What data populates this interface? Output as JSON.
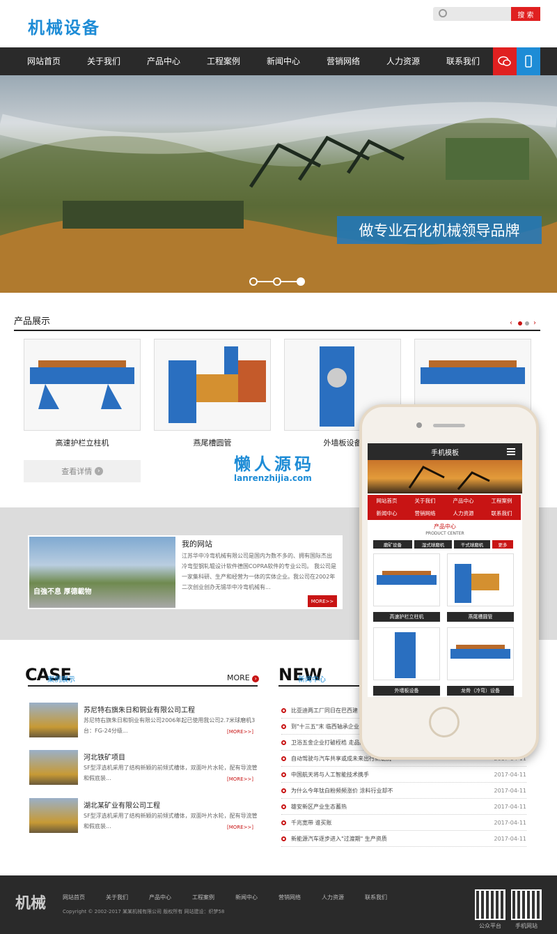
{
  "header": {
    "logo": "机械设备",
    "search": {
      "placeholder": "",
      "button": "搜 索"
    }
  },
  "nav": {
    "items": [
      "网站首页",
      "关于我们",
      "产品中心",
      "工程案例",
      "新闻中心",
      "营销网络",
      "人力资源",
      "联系我们"
    ]
  },
  "banner": {
    "slogan": "做专业石化机械领导品牌",
    "active_slide": 3,
    "slide_count": 3
  },
  "products": {
    "title": "产品展示",
    "items": [
      "高速护栏立柱机",
      "燕尾槽圆管",
      "外墙板设备",
      ""
    ],
    "more_label": "查看详情"
  },
  "about": {
    "title": "我的网站",
    "text": "江苏华中冷弯机械有限公司是国内为数不多的、拥有国际杰出冷弯型钢轧辊设计软件德国COPRA软件的专业公司。 我公司是一家集科研、生产和经营为一体的实体企业。我公司在2002年二次创业创办无锡华中冷弯机械有...",
    "more": "MORE>>",
    "image_text": "自強不息 厚德載物"
  },
  "cases": {
    "heading": "CASE",
    "subheading": "案例展示",
    "more": "MORE",
    "items": [
      {
        "title": "苏尼特右旗朱日和铜业有限公司工程",
        "desc": "苏尼特右旗朱日和铜业有限公司2006年起已使用我公司2.7米球磨机3台：FG-24分级...",
        "link": "[MORE>>]"
      },
      {
        "title": "河北铁矿项目",
        "desc": "SF型浮选机采用了结构新颖的前倾式槽体，双面叶片水轮，配有导流管和假底装...",
        "link": "[MORE>>]"
      },
      {
        "title": "湖北某矿业有限公司工程",
        "desc": "SF型浮选机采用了结构新颖的前倾式槽体，双面叶片水轮，配有导流管和假底装...",
        "link": "[MORE>>]"
      }
    ]
  },
  "news": {
    "heading": "NEW",
    "subheading": "新闻中心",
    "items": [
      {
        "title": "比亚迪两工厂同日在巴西建",
        "date": ""
      },
      {
        "title": "到\"十三五\"末 临西轴承企业",
        "date": ""
      },
      {
        "title": "卫浴五金企业打破桎梏 走品牌建设技术创",
        "date": "2017-04-11"
      },
      {
        "title": "自动驾驶与汽车共享或成未来出行新潮流",
        "date": "2017-04-11"
      },
      {
        "title": "中国航天将与人工智能技术携手",
        "date": "2017-04-11"
      },
      {
        "title": "为什么今年钛白粉频频涨价 涂料行业却不",
        "date": "2017-04-11"
      },
      {
        "title": "雄安新区产业生态蓄热",
        "date": "2017-04-11"
      },
      {
        "title": "千兆宽带 谁买账",
        "date": "2017-04-11"
      },
      {
        "title": "新能源汽车逐步进入\"过渡期\" 生产资质",
        "date": "2017-04-11"
      }
    ]
  },
  "watermark": {
    "title": "懒人源码",
    "url": "lanrenzhijia.com"
  },
  "mobile": {
    "header": "手机模板",
    "nav": [
      "网站首页",
      "关于我们",
      "产品中心",
      "工程案例",
      "新闻中心",
      "营销网络",
      "人力资源",
      "联系我们"
    ],
    "section_title": "产品中心",
    "section_subtitle": "PRODUCT CENTER",
    "tabs": [
      "磨矿设备",
      "湿式球磨机",
      "干式球磨机",
      "更多"
    ],
    "products": [
      "高速护栏立柱机",
      "燕尾槽圆管",
      "外墙板设备",
      "龙骨（冷弯）设备"
    ]
  },
  "footer": {
    "logo": "机械",
    "links": [
      "网站首页",
      "关于我们",
      "产品中心",
      "工程案例",
      "新闻中心",
      "营销网络",
      "人力资源",
      "联系我们"
    ],
    "copyright": "Copyright © 2002-2017 某某机械有限公司 版权所有  网站建设：织梦58",
    "qr_labels": [
      "公众平台",
      "手机网站"
    ]
  },
  "colors": {
    "accent_blue": "#1e8cd6",
    "accent_red": "#e02020",
    "dark": "#2a2a2a"
  }
}
